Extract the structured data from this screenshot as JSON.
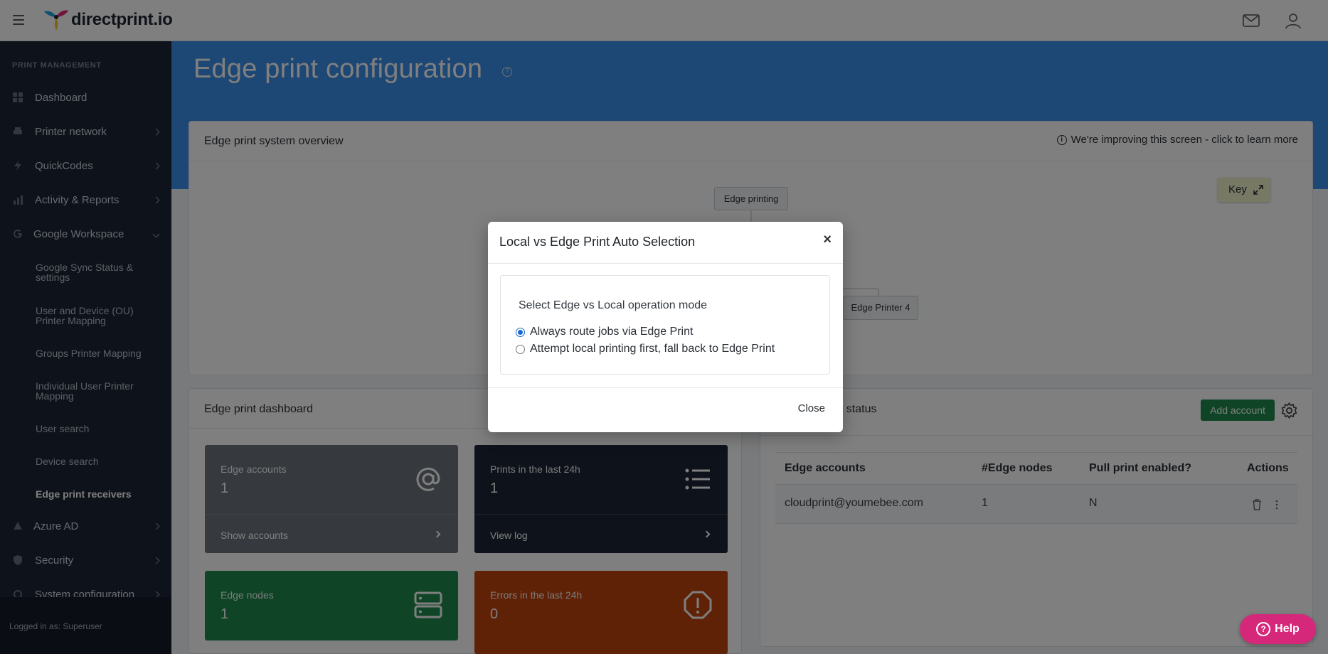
{
  "app": {
    "brand": "directprint.io"
  },
  "sidebar": {
    "section_label": "PRINT MANAGEMENT",
    "items": [
      {
        "label": "Dashboard"
      },
      {
        "label": "Printer network"
      },
      {
        "label": "QuickCodes"
      },
      {
        "label": "Activity & Reports"
      },
      {
        "label": "Google Workspace"
      },
      {
        "label": "Azure AD"
      },
      {
        "label": "Security"
      },
      {
        "label": "System configuration"
      }
    ],
    "sub_items": [
      {
        "label": "Google Sync Status & settings"
      },
      {
        "label": "User and Device (OU) Printer Mapping"
      },
      {
        "label": "Groups Printer Mapping"
      },
      {
        "label": "Individual User Printer Mapping"
      },
      {
        "label": "User search"
      },
      {
        "label": "Device search"
      },
      {
        "label": "Edge print receivers"
      }
    ],
    "footer": "Logged in as: Superuser"
  },
  "page": {
    "title": "Edge print configuration"
  },
  "overview": {
    "title": "Edge print system overview",
    "notice": "We're improving this screen - click to learn more",
    "nodes": [
      "Edge printing",
      "Edge Printer 4"
    ],
    "key_label": "Key"
  },
  "dashboard": {
    "title": "Edge print dashboard",
    "tiles": [
      {
        "label": "Edge accounts",
        "value": "1",
        "footer": "Show accounts",
        "color": "#6c757d"
      },
      {
        "label": "Prints in the last 24h",
        "value": "1",
        "footer": "View log",
        "color": "#1d2535"
      },
      {
        "label": "Edge nodes",
        "value": "1",
        "color": "#1f8b4c"
      },
      {
        "label": "Errors in the last 24h",
        "value": "0",
        "color": "#c0440f"
      }
    ]
  },
  "accounts": {
    "title_partial": "nt status",
    "add_button": "Add account",
    "columns": [
      "Edge accounts",
      "#Edge nodes",
      "Pull print enabled?",
      "Actions"
    ],
    "rows": [
      {
        "account": "cloudprint@youmebee.com",
        "nodes": "1",
        "pull_print": "N"
      }
    ]
  },
  "modal": {
    "title": "Local vs Edge Print Auto Selection",
    "close_symbol": "×",
    "subtitle": "Select Edge vs Local operation mode",
    "options": [
      {
        "label": "Always route jobs via Edge Print",
        "selected": true
      },
      {
        "label": "Attempt local printing first, fall back to Edge Print",
        "selected": false
      }
    ],
    "close_button": "Close"
  },
  "help": {
    "label": "Help"
  },
  "colors": {
    "accent": "#3b8ee8",
    "sidebar": "#1d2535",
    "help": "#d6287a",
    "add": "#1f8b4c"
  }
}
